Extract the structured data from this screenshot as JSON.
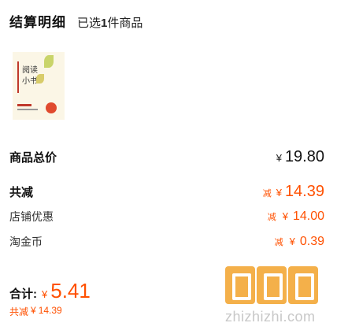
{
  "header": {
    "title": "结算明细",
    "selected_prefix": "已选",
    "selected_count": "1",
    "selected_suffix": "件商品"
  },
  "product": {
    "thumb_line1": "阅读",
    "thumb_line2": "小书"
  },
  "summary": {
    "total_label": "商品总价",
    "total_currency": "¥",
    "total_value": "19.80",
    "discount_label": "共减",
    "discount_tag": "减",
    "discount_currency": "¥",
    "discount_value": "14.39",
    "store_label": "店铺优惠",
    "store_tag": "减",
    "store_currency": "¥",
    "store_value": "14.00",
    "coin_label": "淘金币",
    "coin_tag": "减",
    "coin_currency": "¥",
    "coin_value": "0.39"
  },
  "footer": {
    "sum_label": "合计:",
    "sum_currency": "¥",
    "sum_value": "5.41",
    "saved_label": "共减",
    "saved_currency": "¥",
    "saved_value": "14.39"
  },
  "watermark": {
    "text": "zhizhizhi.com"
  },
  "colors": {
    "accent": "#ff5000",
    "watermark_block": "#f4b04a"
  }
}
